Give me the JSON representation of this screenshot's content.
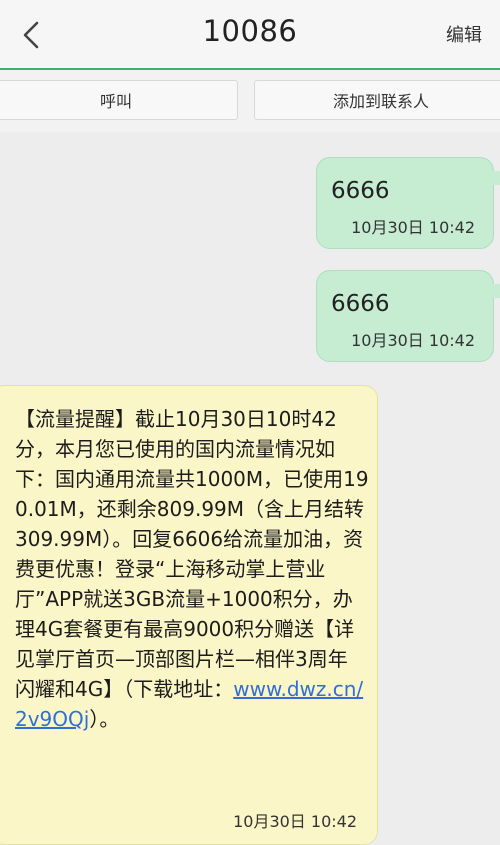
{
  "header": {
    "title": "10086",
    "edit_label": "编辑"
  },
  "actions": {
    "call_label": "呼叫",
    "add_contact_label": "添加到联系人"
  },
  "messages": [
    {
      "direction": "outgoing",
      "text": "6666",
      "time": "10月30日 10:42"
    },
    {
      "direction": "outgoing",
      "text": "6666",
      "time": "10月30日 10:42"
    },
    {
      "direction": "incoming",
      "text": "【流量提醒】截止10月30日10时42分，本月您已使用的国内流量情况如下：国内通用流量共1000M，已使用190.01M，还剩余809.99M（含上月结转309.99M）。回复6606给流量加油，资费更优惠！登录“上海移动掌上营业厅”APP就送3GB流量+1000积分，办理4G套餐更有最高9000积分赠送【详见掌厅首页—顶部图片栏—相伴3周年 闪耀和4G】（下载地址：",
      "link": "www.dwz.cn/2v9OQj",
      "text_after": "）。",
      "time": "10月30日 10:42"
    }
  ],
  "icons": {
    "back": "chevron-left-icon"
  },
  "colors": {
    "accent": "#39b36a",
    "outgoing_bubble": "#c6ecd2",
    "incoming_bubble": "#fbf6c8",
    "link": "#2f6fd6"
  }
}
